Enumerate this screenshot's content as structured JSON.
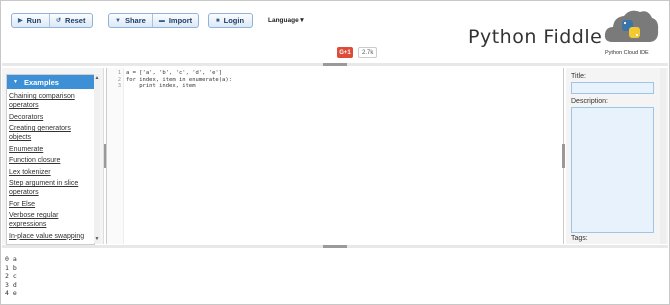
{
  "toolbar": {
    "run_label": "Run",
    "reset_label": "Reset",
    "share_label": "Share",
    "import_label": "Import",
    "login_label": "Login",
    "language_label": "Language▼"
  },
  "brand": {
    "title": "Python Fiddle",
    "tagline": "Python Cloud IDE"
  },
  "social": {
    "gplus_label": "G+1",
    "count": "2.7k"
  },
  "sidebar": {
    "header": "Examples",
    "items": [
      "Chaining comparison operators",
      "Decorators",
      "Creating generators objects",
      "Enumerate",
      "Function closure",
      "Lex tokenizer",
      "Step argument in slice operators",
      "For Else",
      "Verbose regular expressions",
      "In-place value swapping"
    ]
  },
  "editor": {
    "line_numbers": [
      "1",
      "2",
      "3"
    ],
    "lines": [
      "a = ['a', 'b', 'c', 'd', 'e']",
      "for index, item in enumerate(a):",
      "    print index, item"
    ]
  },
  "details": {
    "title_label": "Title:",
    "description_label": "Description:",
    "tags_label": "Tags:"
  },
  "output": {
    "lines": [
      "0 a",
      "1 b",
      "2 c",
      "3 d",
      "4 e"
    ]
  }
}
